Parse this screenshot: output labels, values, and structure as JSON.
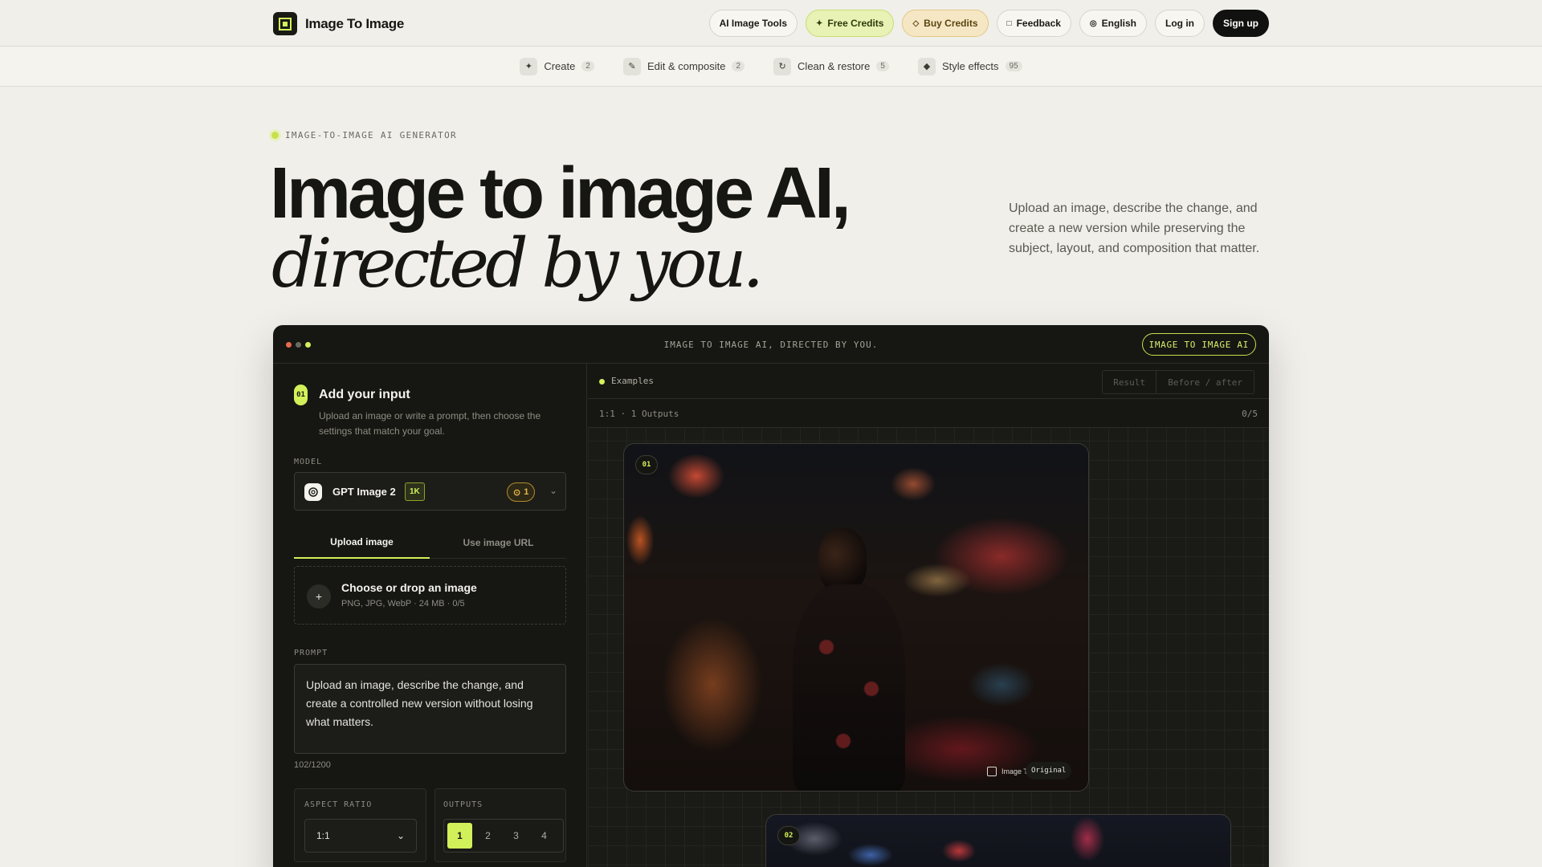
{
  "header": {
    "brand": "Image To Image",
    "nav": {
      "ai_tools": "AI Image Tools",
      "free_credits": "Free Credits",
      "buy_credits": "Buy Credits",
      "feedback": "Feedback",
      "language": "English",
      "login": "Log in",
      "signup": "Sign up"
    }
  },
  "subnav": [
    {
      "label": "Create",
      "count": "2",
      "icon": "sparkle-icon"
    },
    {
      "label": "Edit & composite",
      "count": "2",
      "icon": "pencil-icon"
    },
    {
      "label": "Clean & restore",
      "count": "5",
      "icon": "refresh-icon"
    },
    {
      "label": "Style effects",
      "count": "95",
      "icon": "diamond-icon"
    }
  ],
  "hero": {
    "eyebrow": "IMAGE-TO-IMAGE AI GENERATOR",
    "title_line1": "Image to image AI,",
    "title_line2": "directed by you.",
    "description": "Upload an image, describe the change, and create a new version while preserving the subject, layout, and composition that matter."
  },
  "app": {
    "window_title": "IMAGE TO IMAGE AI, DIRECTED BY YOU.",
    "badge": "IMAGE TO IMAGE AI",
    "step": {
      "number": "01",
      "title": "Add your input",
      "description": "Upload an image or write a prompt, then choose the settings that match your goal."
    },
    "model": {
      "label": "MODEL",
      "name": "GPT Image 2",
      "tag": "1K",
      "credits": "1"
    },
    "tabs": {
      "upload": "Upload image",
      "url": "Use image URL"
    },
    "upload": {
      "title": "Choose or drop an image",
      "subtitle": "PNG, JPG, WebP · 24 MB · 0/5"
    },
    "prompt": {
      "label": "PROMPT",
      "value": "Upload an image, describe the change, and create a controlled new version without losing what matters.",
      "count": "102/1200"
    },
    "aspect": {
      "label": "ASPECT RATIO",
      "value": "1:1"
    },
    "outputs": {
      "label": "OUTPUTS",
      "options": [
        "1",
        "2",
        "3",
        "4"
      ],
      "selected": "1"
    },
    "examples": {
      "label": "Examples",
      "seg_result": "Result",
      "seg_before_after": "Before / after",
      "meta": "1:1 · 1 Outputs",
      "counter": "0/5",
      "cards": [
        {
          "number": "01",
          "watermark": "Image To Image",
          "tag": "Original"
        },
        {
          "number": "02"
        }
      ]
    }
  },
  "colors": {
    "accent": "#d2f05a",
    "background": "#f0efe9",
    "app_background": "#161612"
  }
}
